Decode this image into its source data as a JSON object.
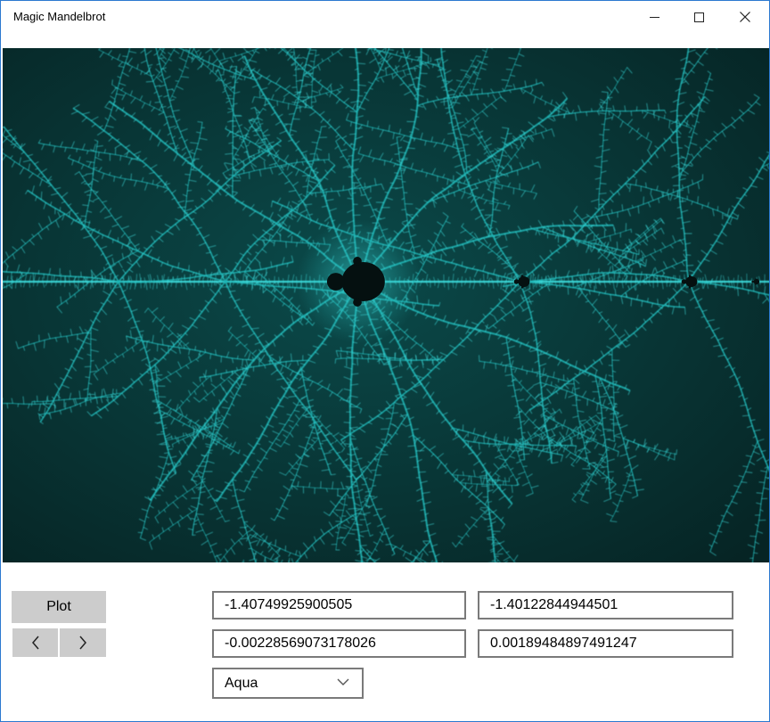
{
  "window": {
    "title": "Magic Mandelbrot",
    "controls": [
      "minimize-icon",
      "maximize-icon",
      "close-icon"
    ]
  },
  "fractal": {
    "colors": {
      "background_dark": "#062424",
      "background_mid": "#0b4a4a",
      "filament": "#1fb7b7",
      "filament_bright": "#3fe0e0",
      "set": "#051010"
    }
  },
  "controls": {
    "plot_label": "Plot",
    "prev_icon": "chevron-left-icon",
    "next_icon": "chevron-right-icon"
  },
  "coordinates": {
    "x_min": "-1.40749925900505",
    "x_max": "-1.40122844944501",
    "y_min": "-0.00228569073178026",
    "y_max": "0.00189484897491247"
  },
  "palette": {
    "selected": "Aqua",
    "icon": "chevron-down-icon"
  }
}
